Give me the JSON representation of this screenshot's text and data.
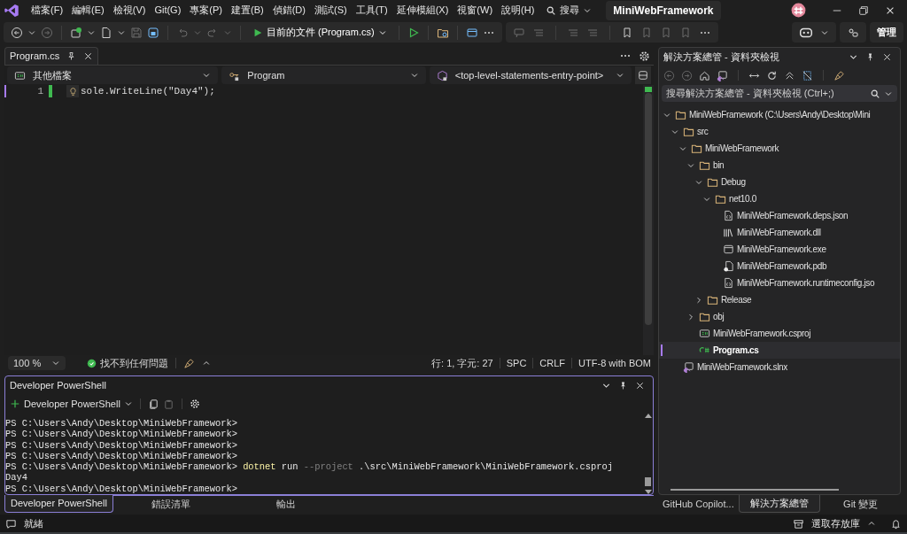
{
  "menu": [
    {
      "label": "檔案(F)"
    },
    {
      "label": "編輯(E)"
    },
    {
      "label": "檢視(V)"
    },
    {
      "label": "Git(G)"
    },
    {
      "label": "專案(P)"
    },
    {
      "label": "建置(B)"
    },
    {
      "label": "偵錯(D)"
    },
    {
      "label": "測試(S)"
    },
    {
      "label": "工具(T)"
    },
    {
      "label": "延伸模組(X)"
    },
    {
      "label": "視窗(W)"
    },
    {
      "label": "說明(H)"
    }
  ],
  "search": {
    "label": "搜尋"
  },
  "window": {
    "title": "MiniWebFramework"
  },
  "toolbar": {
    "run_target": "目前的文件 (Program.cs)",
    "manage": "管理"
  },
  "document": {
    "tabs": [
      {
        "label": "Program.cs",
        "selected": true
      }
    ],
    "nav": {
      "scope": "其他檔案",
      "type": "Program",
      "member": "<top-level-statements-entry-point>"
    },
    "lines": [
      {
        "number": "1",
        "code": "sole.WriteLine(\"Day4\");"
      }
    ],
    "status": {
      "zoom": "100 %",
      "issues": "找不到任何問題",
      "position": "行: 1, 字元: 27",
      "whitespace": "SPC",
      "line_ending": "CRLF",
      "encoding": "UTF-8 with BOM"
    }
  },
  "terminal": {
    "title": "Developer PowerShell",
    "profile": "Developer PowerShell",
    "lines": [
      {
        "segments": [
          {
            "text": "PS C:\\Users\\Andy\\Desktop\\MiniWebFramework>",
            "kind": "plain"
          }
        ]
      },
      {
        "segments": [
          {
            "text": "PS C:\\Users\\Andy\\Desktop\\MiniWebFramework>",
            "kind": "plain"
          }
        ]
      },
      {
        "segments": [
          {
            "text": "PS C:\\Users\\Andy\\Desktop\\MiniWebFramework>",
            "kind": "plain"
          }
        ]
      },
      {
        "segments": [
          {
            "text": "PS C:\\Users\\Andy\\Desktop\\MiniWebFramework>",
            "kind": "plain"
          }
        ]
      },
      {
        "segments": [
          {
            "text": "PS C:\\Users\\Andy\\Desktop\\MiniWebFramework> ",
            "kind": "plain"
          },
          {
            "text": "dotnet",
            "kind": "command"
          },
          {
            "text": " run ",
            "kind": "plain"
          },
          {
            "text": "--project",
            "kind": "parameter"
          },
          {
            "text": " .\\src\\MiniWebFramework\\MiniWebFramework.csproj",
            "kind": "plain"
          }
        ]
      },
      {
        "segments": [
          {
            "text": "Day4",
            "kind": "plain"
          }
        ]
      },
      {
        "segments": [
          {
            "text": "PS C:\\Users\\Andy\\Desktop\\MiniWebFramework>",
            "kind": "plain"
          }
        ]
      }
    ]
  },
  "bottom_tabs": [
    {
      "label": "Developer PowerShell",
      "selected": true
    },
    {
      "label": "錯誤清單",
      "selected": false
    },
    {
      "label": "輸出",
      "selected": false
    }
  ],
  "explorer": {
    "title": "解決方案總管 - 資料夾檢視",
    "search_placeholder": "搜尋解決方案總管 - 資料夾檢視 (Ctrl+;)",
    "tree": [
      {
        "label": "MiniWebFramework (C:\\Users\\Andy\\Desktop\\Mini",
        "kind": "folder",
        "expanded": true,
        "selected": false,
        "children": [
          {
            "label": "src",
            "kind": "folder",
            "expanded": true,
            "selected": false,
            "children": [
              {
                "label": "MiniWebFramework",
                "kind": "folder",
                "expanded": true,
                "selected": false,
                "children": [
                  {
                    "label": "bin",
                    "kind": "folder",
                    "expanded": true,
                    "selected": false,
                    "children": [
                      {
                        "label": "Debug",
                        "kind": "folder",
                        "expanded": true,
                        "selected": false,
                        "children": [
                          {
                            "label": "net10.0",
                            "kind": "folder",
                            "expanded": true,
                            "selected": false,
                            "children": [
                              {
                                "label": "MiniWebFramework.deps.json",
                                "kind": "json",
                                "selected": false
                              },
                              {
                                "label": "MiniWebFramework.dll",
                                "kind": "dll",
                                "selected": false
                              },
                              {
                                "label": "MiniWebFramework.exe",
                                "kind": "exe",
                                "selected": false
                              },
                              {
                                "label": "MiniWebFramework.pdb",
                                "kind": "pdb",
                                "selected": false
                              },
                              {
                                "label": "MiniWebFramework.runtimeconfig.jso",
                                "kind": "json",
                                "selected": false
                              }
                            ]
                          }
                        ]
                      },
                      {
                        "label": "Release",
                        "kind": "folder",
                        "expanded": false,
                        "selected": false
                      }
                    ]
                  },
                  {
                    "label": "obj",
                    "kind": "folder",
                    "expanded": false,
                    "selected": false
                  },
                  {
                    "label": "MiniWebFramework.csproj",
                    "kind": "csproj",
                    "selected": false
                  },
                  {
                    "label": "Program.cs",
                    "kind": "cs",
                    "selected": true
                  }
                ]
              }
            ]
          },
          {
            "label": "MiniWebFramework.slnx",
            "kind": "slnx",
            "selected": false
          }
        ]
      }
    ]
  },
  "side_tabs": [
    {
      "label": "GitHub Copilot...",
      "selected": false
    },
    {
      "label": "解決方案總管",
      "selected": true
    },
    {
      "label": "Git 變更",
      "selected": false
    }
  ],
  "status_bar": {
    "state": "就緒",
    "repository": "選取存放庫"
  }
}
